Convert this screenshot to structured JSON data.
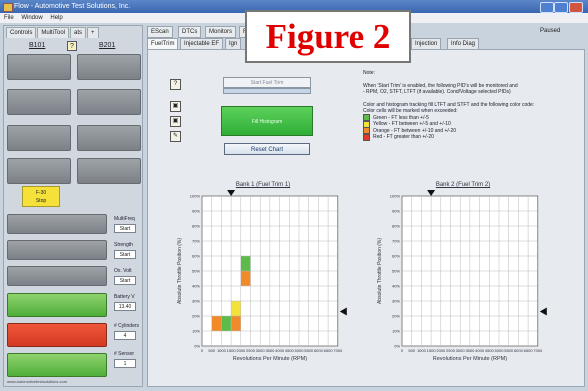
{
  "window": {
    "title": "Flow - Automotive Test Solutions, Inc.",
    "controls": [
      "–",
      "□",
      "×"
    ]
  },
  "menu": [
    "File",
    "Window",
    "Help"
  ],
  "left": {
    "tabs": [
      "Controls",
      "MultiTool",
      "ats",
      "+"
    ],
    "bank1": "B101",
    "bank2": "B201",
    "help": "?",
    "channel_buttons": [
      "",
      "",
      "",
      "",
      "",
      "",
      "",
      ""
    ],
    "active_channel": {
      "line1": "F-30",
      "line2": "Stop"
    },
    "side_labels": [
      "MultiFreq",
      "Strength",
      "Ox. Volt",
      "Battery V",
      "# Cylinders",
      "# Sensor"
    ],
    "side_values": [
      "Start",
      "Start",
      "Start",
      "13.40",
      "4",
      "1"
    ],
    "green_btn": "",
    "red_btn": "",
    "green_btn2": "",
    "footer": "www.automotivetestsolutions.com"
  },
  "toolbar": {
    "tabs": [
      "EScan",
      "DTCs",
      "Monitors",
      "Figure"
    ],
    "right_label": "Paused"
  },
  "subtabs": [
    "FuelTrim",
    "Injectable EF",
    "Ign",
    "Injection",
    "Info Diag"
  ],
  "buttons": {
    "top": "Start Fuel Trim",
    "green": "Fill Histogram",
    "reset": "Reset Chart"
  },
  "tools": [
    "?",
    "▣",
    "▣",
    "✎"
  ],
  "notes": {
    "heading": "Note:",
    "lines": [
      "When 'Start Trim' is enabled, the following PID's will be monitored and",
      "- RPM, O2, STFT, LTFT (if available). Cond/Voltage selected PIDs)",
      "",
      "Color and histogram tracking fill LTFT and STFT and the following color code:",
      "Color cells will be marked when exceeded:",
      "Green - FT less than +/-5",
      "Yellow - FT between +/-5 and +/-10",
      "Orange - FT between +/-10 and +/-20",
      "Red - FT greater than +/-20"
    ],
    "legend_colors": [
      "#5dbb4a",
      "#f2e23a",
      "#f08a2a",
      "#e23a2a"
    ]
  },
  "figure_label": "Figure 2",
  "charts": [
    {
      "title": "Bank 1 (Fuel Trim 1)",
      "ylabel": "Absolute Throttle Position (%)",
      "xlabel": "Revolutions Per Minute (RPM)"
    },
    {
      "title": "Bank 2 (Fuel Trim 2)",
      "ylabel": "Absolute Throttle Position (%)",
      "xlabel": "Revolutions Per Minute (RPM)"
    }
  ],
  "chart_data": [
    {
      "type": "heatmap",
      "title": "Bank 1 (Fuel Trim 1)",
      "xlabel": "Revolutions Per Minute (RPM)",
      "ylabel": "Absolute Throttle Position (%)",
      "x_ticks": [
        "0",
        "500",
        "1000",
        "1500",
        "2000",
        "2500",
        "3000",
        "3500",
        "4000",
        "4500",
        "5000",
        "5500",
        "6000",
        "6500",
        "7000"
      ],
      "y_ticks": [
        "100%",
        "90%",
        "80%",
        "70%",
        "60%",
        "50%",
        "40%",
        "30%",
        "20%",
        "10%",
        "0%"
      ],
      "cells": [
        {
          "col": 1,
          "row": 8,
          "color": "#f08a2a"
        },
        {
          "col": 2,
          "row": 8,
          "color": "#5dbb4a"
        },
        {
          "col": 3,
          "row": 8,
          "color": "#f08a2a"
        },
        {
          "col": 3,
          "row": 7,
          "color": "#f2e23a"
        },
        {
          "col": 4,
          "row": 4,
          "color": "#5dbb4a"
        },
        {
          "col": 4,
          "row": 5,
          "color": "#f08a2a"
        }
      ]
    },
    {
      "type": "heatmap",
      "title": "Bank 2 (Fuel Trim 2)",
      "xlabel": "Revolutions Per Minute (RPM)",
      "ylabel": "Absolute Throttle Position (%)",
      "x_ticks": [
        "0",
        "500",
        "1000",
        "1500",
        "2000",
        "2500",
        "3000",
        "3500",
        "4000",
        "4500",
        "5000",
        "5500",
        "6000",
        "6500",
        "7000"
      ],
      "y_ticks": [
        "100%",
        "90%",
        "80%",
        "70%",
        "60%",
        "50%",
        "40%",
        "30%",
        "20%",
        "10%",
        "0%"
      ],
      "cells": []
    }
  ]
}
